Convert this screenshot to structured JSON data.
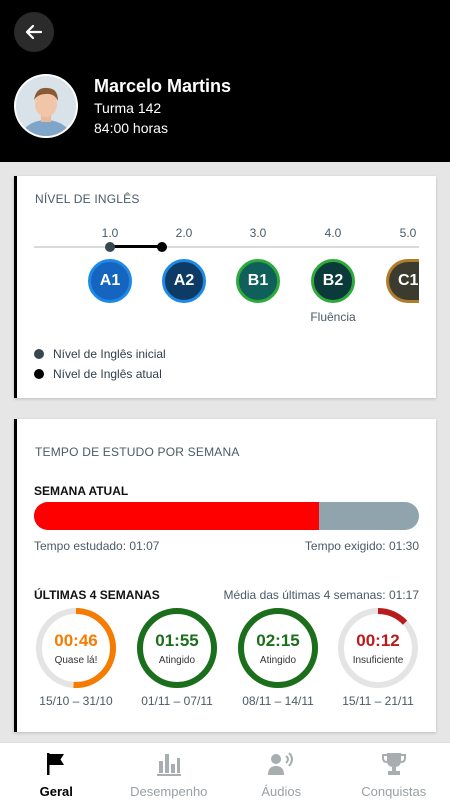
{
  "profile": {
    "name": "Marcelo Martins",
    "class_label": "Turma 142",
    "hours": "84:00 horas"
  },
  "english_level": {
    "title": "NÍVEL DE INGLÊS",
    "scale": [
      "1.0",
      "2.0",
      "3.0",
      "4.0",
      "5.0"
    ],
    "initial_value": 1.0,
    "current_value": 1.7,
    "levels": [
      {
        "code": "A1",
        "color": "#1565c0",
        "border": "#1e88e5"
      },
      {
        "code": "A2",
        "color": "#0d3b66",
        "border": "#1e88e5"
      },
      {
        "code": "B1",
        "color": "#0f5f5a",
        "border": "#2eaa3a"
      },
      {
        "code": "B2",
        "color": "#0b3a3a",
        "border": "#2eaa3a"
      },
      {
        "code": "C1",
        "color": "#3b3b2f",
        "border": "#b07d2b"
      }
    ],
    "fluency_label": "Fluência",
    "legend": {
      "initial": "Nível de Inglês inicial",
      "current": "Nível de Inglês atual"
    },
    "colors": {
      "initial": "#37474f",
      "current": "#000000"
    }
  },
  "study_time": {
    "title": "TEMPO DE ESTUDO POR SEMANA",
    "current_week_label": "SEMANA ATUAL",
    "studied_label": "Tempo estudado: 01:07",
    "required_label": "Tempo exigido: 01:30",
    "progress_fraction": 0.74,
    "last_weeks_label": "ÚLTIMAS 4 SEMANAS",
    "average_label": "Média das últimas 4 semanas: 01:17",
    "weeks": [
      {
        "time": "00:46",
        "status": "Quase lá!",
        "dates": "15/10 – 31/10",
        "fraction": 0.51,
        "color": "#f57c00"
      },
      {
        "time": "01:55",
        "status": "Atingido",
        "dates": "01/11 – 07/11",
        "fraction": 1.0,
        "color": "#1b6e1b"
      },
      {
        "time": "02:15",
        "status": "Atingido",
        "dates": "08/11 – 14/11",
        "fraction": 1.0,
        "color": "#1b6e1b"
      },
      {
        "time": "00:12",
        "status": "Insuficiente",
        "dates": "15/11 – 21/11",
        "fraction": 0.13,
        "color": "#b71c1c"
      }
    ]
  },
  "nav": {
    "items": [
      {
        "label": "Geral",
        "icon": "flag-icon",
        "active": true
      },
      {
        "label": "Desempenho",
        "icon": "bar-chart-icon",
        "active": false
      },
      {
        "label": "Áudios",
        "icon": "speaker-icon",
        "active": false
      },
      {
        "label": "Conquistas",
        "icon": "trophy-icon",
        "active": false
      }
    ]
  }
}
